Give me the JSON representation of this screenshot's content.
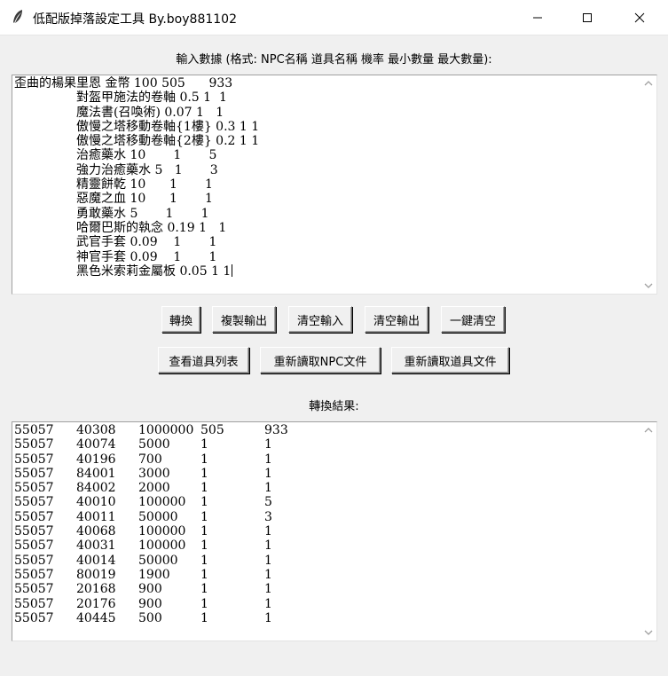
{
  "window": {
    "title": "低配版掉落設定工具 By.boy881102",
    "icons": {
      "app": "feather-icon",
      "minimize": "minimize-icon",
      "maximize": "maximize-icon",
      "close": "close-icon"
    }
  },
  "input": {
    "label": "輸入數據 (格式: NPC名稱 道具名稱 機率 最小數量 最大數量):",
    "lines": [
      "歪曲的楊果里恩 金幣 100 505      933",
      "對盔甲施法的卷軸 0.5 1  1",
      "魔法書(召喚術) 0.07 1   1",
      "傲慢之塔移動卷軸{1樓} 0.3 1 1",
      "傲慢之塔移動卷軸{2樓} 0.2 1 1",
      "治癒藥水 10       1       5",
      "強力治癒藥水 5   1       3",
      "精靈餅乾 10      1       1",
      "惡魔之血 10      1       1",
      "勇敢藥水 5       1       1",
      "哈爾巴斯的執念 0.19 1   1",
      "武官手套 0.09    1       1",
      "神官手套 0.09    1       1",
      "黑色米索莉金屬板 0.05 1 1"
    ]
  },
  "buttons": {
    "convert": "轉換",
    "copy_output": "複製輸出",
    "clear_input": "清空輸入",
    "clear_output": "清空輸出",
    "clear_all": "一鍵清空",
    "view_items": "查看道具列表",
    "reload_npc": "重新讀取NPC文件",
    "reload_items": "重新讀取道具文件"
  },
  "output": {
    "label": "轉換結果:",
    "rows": [
      [
        "55057",
        "40308",
        "1000000",
        "505",
        "933"
      ],
      [
        "55057",
        "40074",
        "5000",
        "1",
        "1"
      ],
      [
        "55057",
        "40196",
        "700",
        "1",
        "1"
      ],
      [
        "55057",
        "84001",
        "3000",
        "1",
        "1"
      ],
      [
        "55057",
        "84002",
        "2000",
        "1",
        "1"
      ],
      [
        "55057",
        "40010",
        "100000",
        "1",
        "5"
      ],
      [
        "55057",
        "40011",
        "50000",
        "1",
        "3"
      ],
      [
        "55057",
        "40068",
        "100000",
        "1",
        "1"
      ],
      [
        "55057",
        "40031",
        "100000",
        "1",
        "1"
      ],
      [
        "55057",
        "40014",
        "50000",
        "1",
        "1"
      ],
      [
        "55057",
        "80019",
        "1900",
        "1",
        "1"
      ],
      [
        "55057",
        "20168",
        "900",
        "1",
        "1"
      ],
      [
        "55057",
        "20176",
        "900",
        "1",
        "1"
      ],
      [
        "55057",
        "40445",
        "500",
        "1",
        "1"
      ]
    ]
  }
}
